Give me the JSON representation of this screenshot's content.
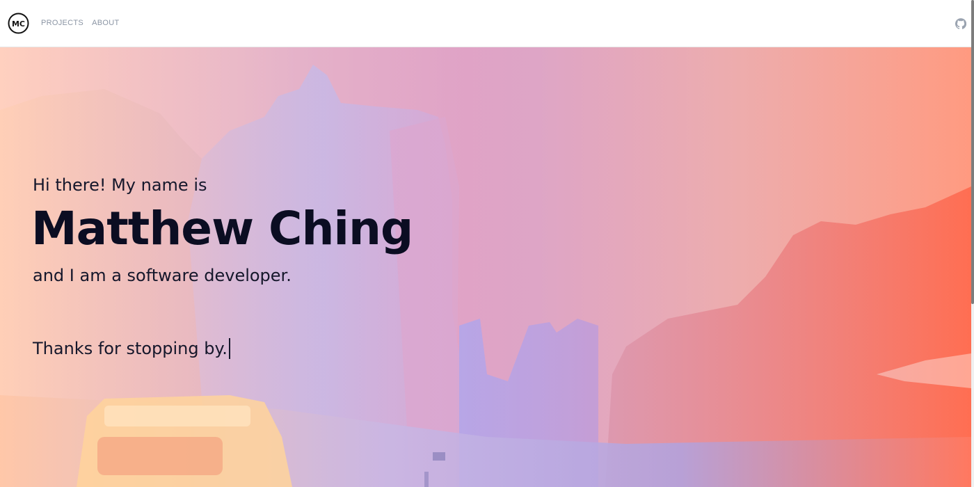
{
  "header": {
    "logo_text": "MC",
    "nav": [
      {
        "label": "PROJECTS"
      },
      {
        "label": "ABOUT"
      }
    ],
    "github_icon": "github-icon"
  },
  "hero": {
    "greeting": "Hi there! My name is",
    "name": "Matthew Ching",
    "tagline": "and I am a software developer.",
    "thanks": "Thanks for stopping by."
  },
  "colors": {
    "nav_text": "#8a94a3",
    "heading_text": "#0b0d22",
    "body_text": "#15172b",
    "gradient_left": "#ffc3a8",
    "gradient_mid": "#f5a3b8",
    "gradient_purple": "#b6a6e6",
    "gradient_right": "#ff7a5c"
  }
}
